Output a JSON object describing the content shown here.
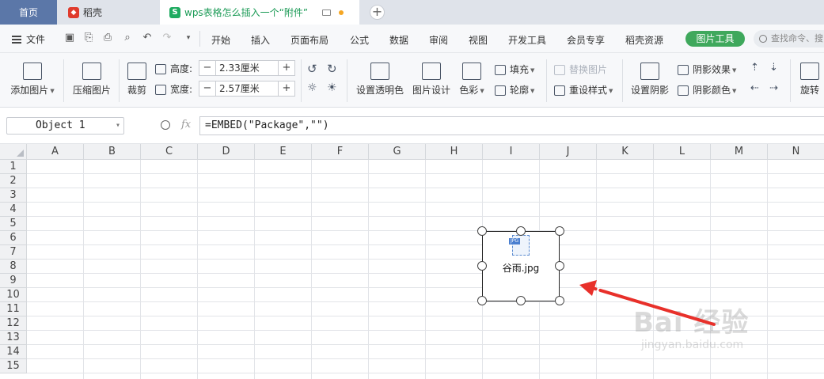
{
  "tabs": {
    "home": "首页",
    "daoke": "稻壳",
    "doc": "wps表格怎么插入一个“附件”"
  },
  "menubar": {
    "file": "文件",
    "items": [
      "开始",
      "插入",
      "页面布局",
      "公式",
      "数据",
      "审阅",
      "视图",
      "开发工具",
      "会员专享",
      "稻壳资源"
    ],
    "picture_tools": "图片工具",
    "search_placeholder": "查找命令、搜"
  },
  "ribbon": {
    "add_picture": "添加图片",
    "compress_picture": "压缩图片",
    "crop": "裁剪",
    "height_label": "高度:",
    "height_value": "2.33厘米",
    "width_label": "宽度:",
    "width_value": "2.57厘米",
    "set_transparent": "设置透明色",
    "picture_design": "图片设计",
    "color": "色彩",
    "fill": "填充",
    "outline": "轮廓",
    "replace_picture": "替换图片",
    "reset_style": "重设样式",
    "set_shadow": "设置阴影",
    "shadow_effect": "阴影效果",
    "shadow_color": "阴影颜色",
    "rotate": "旋转"
  },
  "formula_bar": {
    "name_box": "Object 1",
    "fx": "fx",
    "formula": "=EMBED(\"Package\",\"\")"
  },
  "grid": {
    "columns": [
      "A",
      "B",
      "C",
      "D",
      "E",
      "F",
      "G",
      "H",
      "I",
      "J",
      "K",
      "L",
      "M",
      "N"
    ],
    "rows": [
      "1",
      "2",
      "3",
      "4",
      "5",
      "6",
      "7",
      "8",
      "9",
      "10",
      "11",
      "12",
      "13",
      "14",
      "15"
    ]
  },
  "embedded_object": {
    "filename": "谷雨.jpg",
    "badge": "JPG"
  },
  "watermark": {
    "main": "Bai 经验",
    "sub": "jingyan.baidu.com"
  }
}
